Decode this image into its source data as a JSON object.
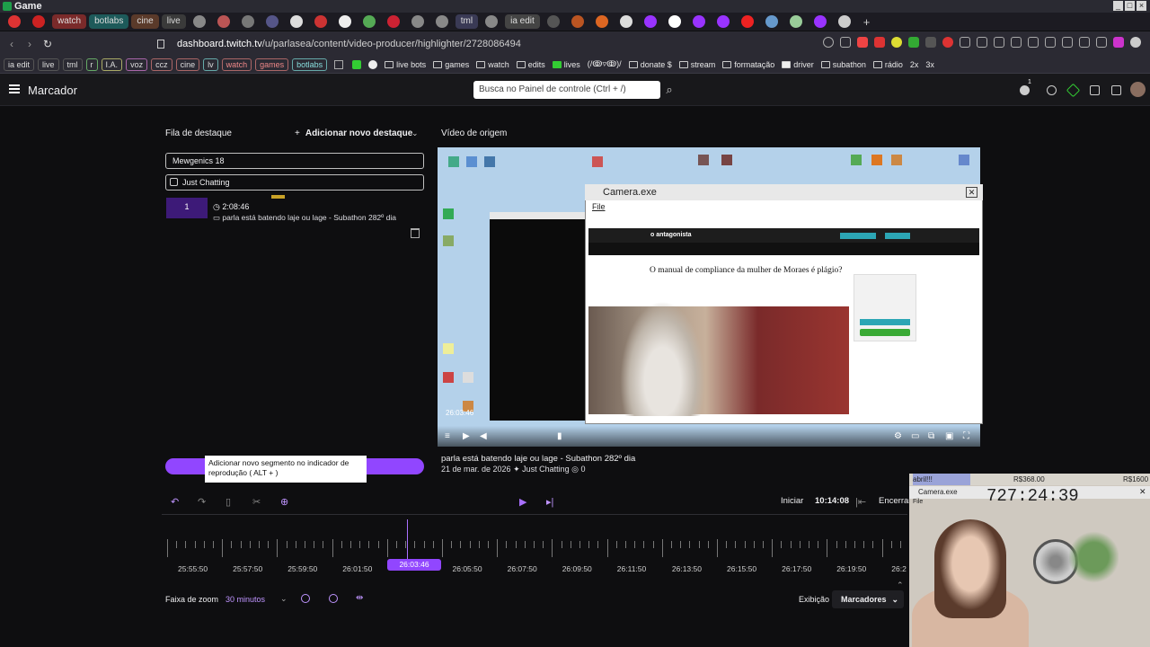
{
  "window": {
    "title": "Game"
  },
  "tabs": [
    "watch",
    "botlabs",
    "cine",
    "live",
    "tml",
    "ia edit"
  ],
  "address": {
    "host": "dashboard.twitch.tv",
    "path": "/u/parlasea/content/video-producer/highlighter/2728086494"
  },
  "bookmarks": {
    "chips": [
      "ia edit",
      "live",
      "tml",
      "r",
      "I.A.",
      "voz",
      "ccz",
      "cine",
      "lv",
      "watch",
      "games",
      "botlabs"
    ],
    "folders": [
      "live bots",
      "games",
      "watch",
      "edits",
      "lives",
      "(/ↂ▿ↂ)/",
      "donate $",
      "stream",
      "formatação",
      "driver",
      "subathon",
      "rádio",
      "2x",
      "3x"
    ]
  },
  "app": {
    "title": "Marcador",
    "search_placeholder": "Busca no Painel de controle (Ctrl + /)",
    "notif_count": "1"
  },
  "queue": {
    "label": "Fila de destaque",
    "add": "Adicionar novo destaque",
    "field1": "Mewgenics 18",
    "field2": "Just Chatting",
    "item_index": "1",
    "item_time": "2:08:46",
    "item_title": "parla está batendo laje ou lage - Subathon 282º dia",
    "add_segment_tooltip": "Adicionar novo segmento no indicador de reprodução ( ALT + )"
  },
  "source": {
    "label": "Vídeo de origem",
    "video_timestamp": "26:03:46",
    "video_title": "parla está batendo laje ou lage - Subathon 282º dia",
    "date": "21 de mar. de 2026",
    "category": "Just Chatting",
    "views": "0"
  },
  "camera": {
    "title": "Camera.exe",
    "menu_file": "File",
    "site": "o antagonista",
    "headline": "O manual de compliance da mulher de Moraes é plágio?"
  },
  "timeline": {
    "start_label": "Iniciar",
    "start_time": "10:14:08",
    "end_label": "Encerrar",
    "ticks": [
      "25:55:50",
      "25:57:50",
      "25:59:50",
      "26:01:50",
      "26:03:46",
      "26:05:50",
      "26:07:50",
      "26:09:50",
      "26:11:50",
      "26:13:50",
      "26:15:50",
      "26:17:50",
      "26:19:50",
      "26:2"
    ],
    "zoom_label": "Faixa de zoom",
    "zoom_value": "30 minutos",
    "view_label": "Exibição",
    "view_value": "Marcadores"
  },
  "overlay": {
    "left": "abril!!!",
    "mid": "R$368.00",
    "right": "R$1600",
    "cam_title": "Camera.exe",
    "file": "File",
    "timer": "727:24:39"
  }
}
